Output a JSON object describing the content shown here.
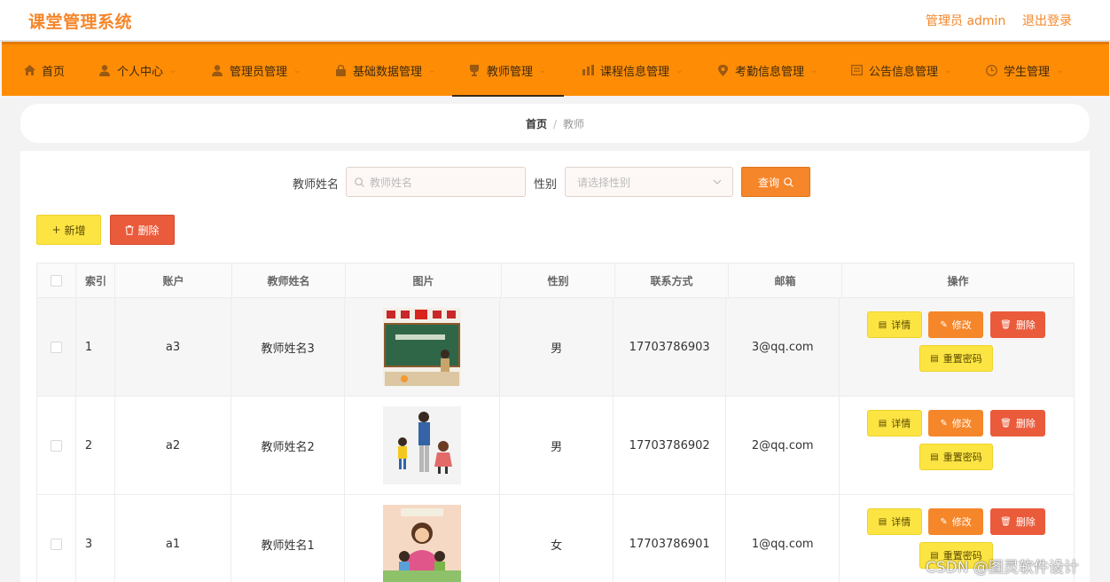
{
  "header": {
    "app_title": "课堂管理系统",
    "user_label": "管理员 admin",
    "logout_label": "退出登录"
  },
  "nav": {
    "items": [
      {
        "label": "首页",
        "icon": "home-icon",
        "has_dropdown": false
      },
      {
        "label": "个人中心",
        "icon": "user-icon",
        "has_dropdown": true
      },
      {
        "label": "管理员管理",
        "icon": "user-icon",
        "has_dropdown": true
      },
      {
        "label": "基础数据管理",
        "icon": "lock-icon",
        "has_dropdown": true
      },
      {
        "label": "教师管理",
        "icon": "cup-icon",
        "has_dropdown": true,
        "active": true
      },
      {
        "label": "课程信息管理",
        "icon": "chart-icon",
        "has_dropdown": true
      },
      {
        "label": "考勤信息管理",
        "icon": "location-icon",
        "has_dropdown": true
      },
      {
        "label": "公告信息管理",
        "icon": "doc-icon",
        "has_dropdown": true
      },
      {
        "label": "学生管理",
        "icon": "clock-icon",
        "has_dropdown": true
      }
    ]
  },
  "breadcrumb": {
    "home": "首页",
    "separator": "/",
    "current": "教师"
  },
  "search": {
    "name_label": "教师姓名",
    "name_placeholder": "教师姓名",
    "sex_label": "性别",
    "sex_placeholder": "请选择性别",
    "query_label": "查询"
  },
  "actions": {
    "add_label": "新增",
    "delete_label": "删除"
  },
  "table": {
    "headers": [
      "索引",
      "账户",
      "教师姓名",
      "图片",
      "性别",
      "联系方式",
      "邮箱",
      "操作"
    ],
    "rows": [
      {
        "index": "1",
        "account": "a3",
        "name": "教师姓名3",
        "picture": "teachers-day-blackboard",
        "sex": "男",
        "phone": "17703786903",
        "email": "3@qq.com"
      },
      {
        "index": "2",
        "account": "a2",
        "name": "教师姓名2",
        "picture": "teacher-with-children",
        "sex": "男",
        "phone": "17703786902",
        "email": "2@qq.com"
      },
      {
        "index": "3",
        "account": "a1",
        "name": "教师姓名1",
        "picture": "teacher-with-students",
        "sex": "女",
        "phone": "17703786901",
        "email": "1@qq.com"
      }
    ],
    "row_actions": {
      "detail": "详情",
      "edit": "修改",
      "delete": "删除",
      "reset": "重置密码"
    }
  },
  "watermark": "CSDN @图灵软件设计",
  "colors": {
    "accent": "#f5862a",
    "nav_bg": "#fe8c05",
    "yellow_btn": "#fce443",
    "red_btn": "#ea5b3b"
  }
}
